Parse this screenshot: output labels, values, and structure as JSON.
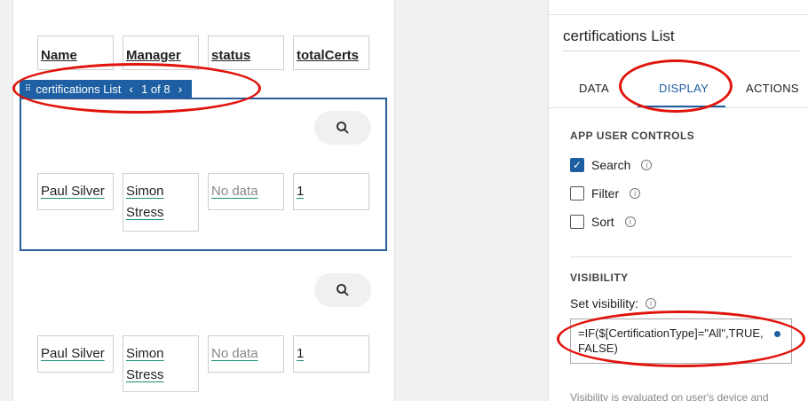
{
  "table": {
    "headers": [
      "Name",
      "Manager",
      "status",
      "totalCerts"
    ],
    "rows": [
      {
        "name": "Paul Silver",
        "manager": "Simon Stress",
        "status": "No data",
        "totalCerts": "1"
      },
      {
        "name": "Paul Silver",
        "manager": "Simon Stress",
        "status": "No data",
        "totalCerts": "1"
      }
    ]
  },
  "list_tag": {
    "label": "certifications List",
    "pager": "1 of 8",
    "prev_icon": "chevron-left-icon",
    "next_icon": "chevron-right-icon"
  },
  "panel": {
    "title": "certifications List",
    "tabs": [
      "DATA",
      "DISPLAY",
      "ACTIONS"
    ],
    "active_tab": "DISPLAY",
    "app_user_controls": {
      "heading": "APP USER CONTROLS",
      "items": [
        {
          "label": "Search",
          "checked": true
        },
        {
          "label": "Filter",
          "checked": false
        },
        {
          "label": "Sort",
          "checked": false
        }
      ]
    },
    "visibility": {
      "heading": "VISIBILITY",
      "label": "Set visibility:",
      "formula": "=IF($[CertificationType]=\"All\",TRUE,FALSE)",
      "note": "Visibility is evaluated on user's device and"
    }
  },
  "colors": {
    "accent": "#1e5fa3",
    "annotation": "#e0140c",
    "underline": "#1a8f7b"
  }
}
